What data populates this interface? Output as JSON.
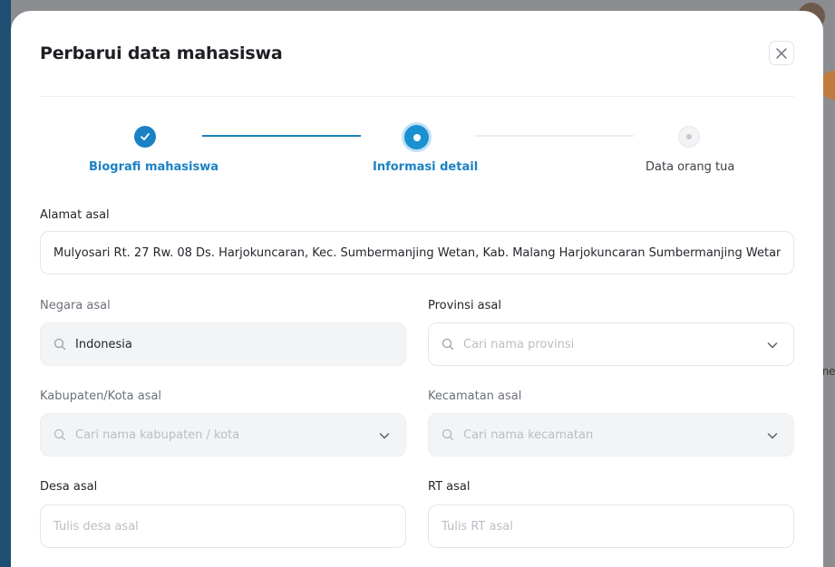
{
  "modal": {
    "title": "Perbarui data mahasiswa"
  },
  "stepper": {
    "steps": [
      {
        "label": "Biografi mahasiswa",
        "state": "completed"
      },
      {
        "label": "Informasi detail",
        "state": "active"
      },
      {
        "label": "Data orang tua",
        "state": "pending"
      }
    ]
  },
  "form": {
    "alamat": {
      "label": "Alamat asal",
      "value": "Mulyosari Rt. 27 Rw. 08 Ds. Harjokuncaran, Kec. Sumbermanjing Wetan, Kab. Malang Harjokuncaran Sumbermanjing Wetan Malang"
    },
    "negara": {
      "label": "Negara asal",
      "value": "Indonesia"
    },
    "provinsi": {
      "label": "Provinsi asal",
      "placeholder": "Cari nama provinsi"
    },
    "kabupaten": {
      "label": "Kabupaten/Kota asal",
      "placeholder": "Cari nama kabupaten / kota"
    },
    "kecamatan": {
      "label": "Kecamatan asal",
      "placeholder": "Cari nama kecamatan"
    },
    "desa": {
      "label": "Desa asal",
      "placeholder": "Tulis desa asal"
    },
    "rt": {
      "label": "RT asal",
      "placeholder": "Tulis RT asal"
    }
  },
  "colors": {
    "accent": "#1a82c4",
    "overlay": "#8b8d90"
  }
}
